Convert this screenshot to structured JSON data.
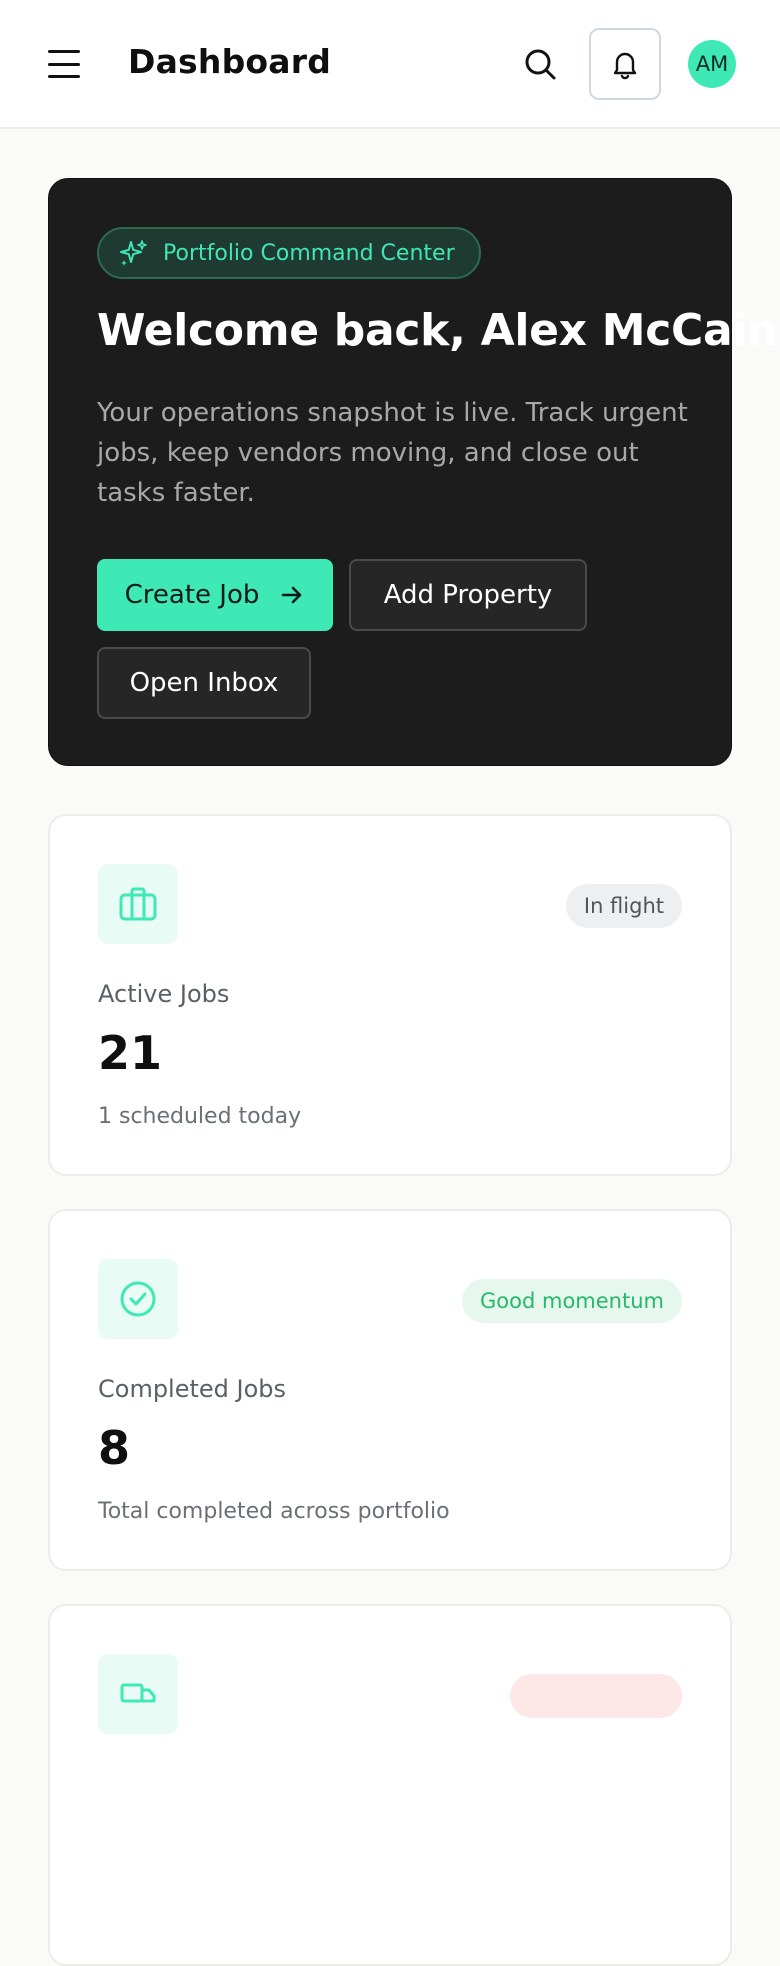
{
  "header": {
    "title": "Dashboard",
    "avatar_initials": "AM"
  },
  "hero": {
    "badge": "Portfolio Command Center",
    "title": "Welcome back, Alex McCain",
    "description": "Your operations snapshot is live. Track urgent jobs, keep vendors moving, and close out tasks faster.",
    "buttons": {
      "create_job": "Create Job",
      "add_property": "Add Property",
      "open_inbox": "Open Inbox"
    }
  },
  "stats": [
    {
      "icon": "briefcase-icon",
      "label": "Active Jobs",
      "value": "21",
      "sub": "1 scheduled today",
      "pill": "In flight",
      "pill_color": "#50555c"
    },
    {
      "icon": "check-circle-icon",
      "label": "Completed Jobs",
      "value": "8",
      "sub": "Total completed across portfolio",
      "pill": "Good momentum",
      "pill_color": "#26b96b"
    },
    {
      "icon": "truck-icon",
      "pill_color": "#e04a4a"
    }
  ],
  "colors": {
    "accent": "#3fe9b6",
    "hero_bg": "#1c1c1c",
    "page_bg": "#fafaf9"
  }
}
